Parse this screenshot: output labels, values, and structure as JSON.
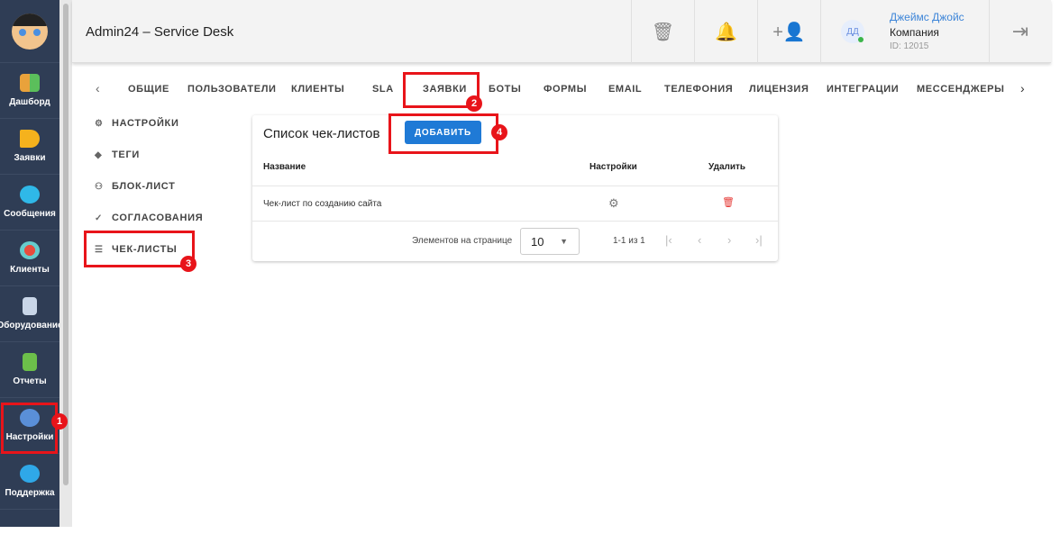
{
  "app": {
    "title": "Admin24 – Service Desk"
  },
  "sidebar": {
    "items": [
      {
        "label": "Дашборд",
        "color": "#e9a23b"
      },
      {
        "label": "Заявки",
        "color": "#f5b21d"
      },
      {
        "label": "Сообщения",
        "color": "#2fb8e8"
      },
      {
        "label": "Клиенты",
        "color": "#e84c3d"
      },
      {
        "label": "Оборудование",
        "color": "#c9d6e8"
      },
      {
        "label": "Отчеты",
        "color": "#6cbf4a"
      },
      {
        "label": "Настройки",
        "color": "#5a8fd8"
      },
      {
        "label": "Поддержка",
        "color": "#2fa8e8"
      }
    ]
  },
  "header": {
    "icons": [
      "trash-icon",
      "bell-icon",
      "add-user-icon",
      "logout-icon"
    ],
    "user": {
      "initials": "ДД",
      "name": "Джеймс Джойс",
      "company": "Компания",
      "id": "ID: 12015"
    }
  },
  "tabs": [
    "ОБЩИЕ",
    "ПОЛЬЗОВАТЕЛИ",
    "КЛИЕНТЫ",
    "SLA",
    "ЗАЯВКИ",
    "БОТЫ",
    "ФОРМЫ",
    "EMAIL",
    "ТЕЛЕФОНИЯ",
    "ЛИЦЕНЗИЯ",
    "ИНТЕГРАЦИИ",
    "МЕССЕНДЖЕРЫ"
  ],
  "submenu": [
    "НАСТРОЙКИ",
    "ТЕГИ",
    "БЛОК-ЛИСТ",
    "СОГЛАСОВАНИЯ",
    "ЧЕК-ЛИСТЫ"
  ],
  "card": {
    "title": "Список чек-листов",
    "add": "ДОБАВИТЬ",
    "columns": [
      "Название",
      "Настройки",
      "Удалить"
    ],
    "rows": [
      {
        "name": "Чек-лист по созданию сайта"
      }
    ],
    "per_page_label": "Элементов на странице",
    "per_page": "10",
    "range": "1-1 из 1"
  },
  "annotations": [
    "1",
    "2",
    "3",
    "4"
  ],
  "colors": {
    "accent": "#1f7ad6",
    "sidebar": "#2f3d55",
    "highlight": "#e8141a"
  }
}
